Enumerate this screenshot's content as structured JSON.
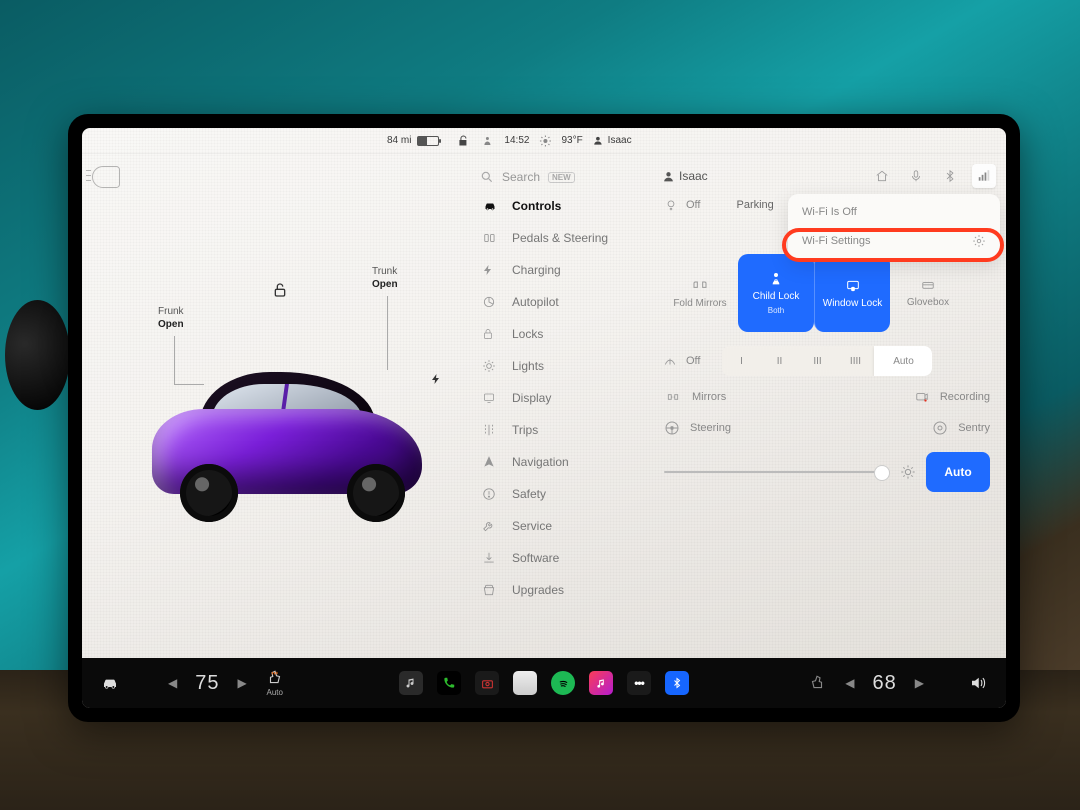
{
  "status_bar": {
    "range": "84 mi",
    "time": "14:52",
    "temperature": "93°F",
    "profile_name": "Isaac"
  },
  "car_pane": {
    "frunk_label": "Frunk",
    "frunk_state": "Open",
    "trunk_label": "Trunk",
    "trunk_state": "Open"
  },
  "menu": {
    "search_placeholder": "Search",
    "search_badge": "NEW",
    "items": [
      {
        "icon": "car-icon",
        "label": "Controls",
        "selected": true
      },
      {
        "icon": "pedals-icon",
        "label": "Pedals & Steering"
      },
      {
        "icon": "charging-icon",
        "label": "Charging"
      },
      {
        "icon": "autopilot-icon",
        "label": "Autopilot"
      },
      {
        "icon": "lock-icon",
        "label": "Locks"
      },
      {
        "icon": "lights-icon",
        "label": "Lights"
      },
      {
        "icon": "display-icon",
        "label": "Display"
      },
      {
        "icon": "trips-icon",
        "label": "Trips"
      },
      {
        "icon": "navigation-icon",
        "label": "Navigation"
      },
      {
        "icon": "safety-icon",
        "label": "Safety"
      },
      {
        "icon": "service-icon",
        "label": "Service"
      },
      {
        "icon": "software-icon",
        "label": "Software"
      },
      {
        "icon": "upgrades-icon",
        "label": "Upgrades"
      }
    ]
  },
  "content": {
    "profile_name": "Isaac",
    "wifi_dropdown": {
      "status": "Wi-Fi Is Off",
      "settings_label": "Wi-Fi Settings"
    },
    "lights_label": "Off",
    "parking_label": "Parking",
    "lock_tiles": {
      "fold_mirrors": "Fold Mirrors",
      "child_lock": "Child Lock",
      "child_lock_sub": "Both",
      "window_lock": "Window Lock",
      "glovebox": "Glovebox"
    },
    "wipers": {
      "label": "Off",
      "levels": [
        "I",
        "II",
        "III",
        "IIII"
      ],
      "auto": "Auto"
    },
    "mirrors_label": "Mirrors",
    "recording_label": "Recording",
    "steering_label": "Steering",
    "sentry_label": "Sentry",
    "brightness_auto": "Auto"
  },
  "dock": {
    "left_temp": "75",
    "right_temp": "68",
    "seat_mode": "Auto"
  }
}
